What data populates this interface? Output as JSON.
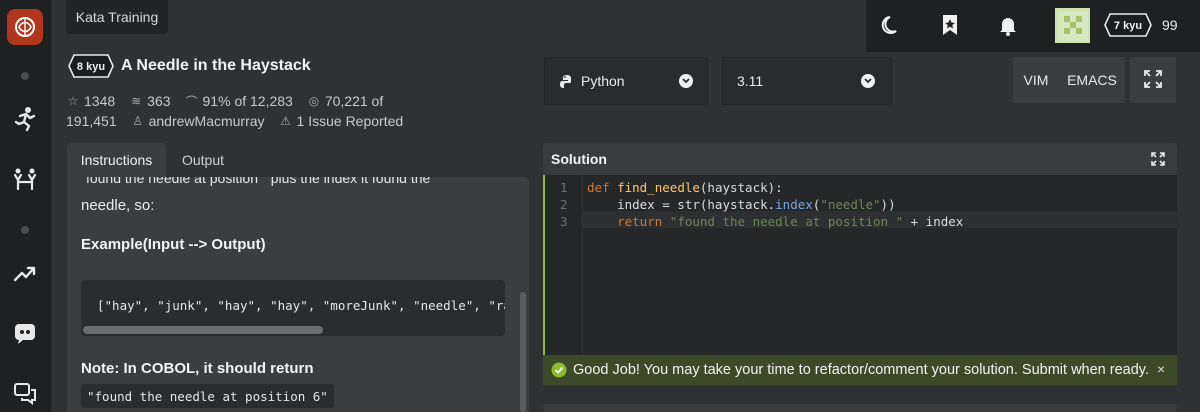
{
  "header": {
    "kata_label": "Kata Training",
    "title": "A Needle in the Haystack",
    "kyu_badge": "8 kyu"
  },
  "stats": {
    "stars": "1348",
    "collections": "363",
    "satisfaction": "91%",
    "satisfaction_of": "of 12,283",
    "completed": "70,221 of",
    "total": "191,451",
    "author": "andrewMacmurray",
    "issues": "1 Issue Reported"
  },
  "tabs": {
    "instructions": "Instructions",
    "output": "Output"
  },
  "instructions": {
    "cut_line": "\"found the needle at position \" plus the index it found the",
    "needle_line": "needle, so:",
    "example_heading": "Example(Input --> Output)",
    "example_code": "[\"hay\", \"junk\", \"hay\", \"hay\", \"moreJunk\", \"needle\", \"randomJunk\"]",
    "note": "Note: In COBOL, it should return",
    "note_code": "\"found the needle at position 6\""
  },
  "toolbar": {
    "language": "Python",
    "version": "3.11",
    "vim": "VIM",
    "emacs": "EMACS",
    "rank": "7 kyu",
    "honor": "99"
  },
  "solution": {
    "title": "Solution",
    "lines": [
      {
        "n": "1",
        "code": "def find_needle(haystack):"
      },
      {
        "n": "2",
        "code": "    index = str(haystack.index(\"needle\"))"
      },
      {
        "n": "3",
        "code": "    return \"found the needle at position \" + index"
      }
    ]
  },
  "toast": {
    "message": "Good Job! You may take your time to refactor/comment your solution. Submit when ready.",
    "close": "×"
  },
  "icons": {
    "logo": "codewars-logo-icon",
    "accent": "#b1361e",
    "editor_accent": "#8dbb2f",
    "success": "#8dbb2f"
  }
}
